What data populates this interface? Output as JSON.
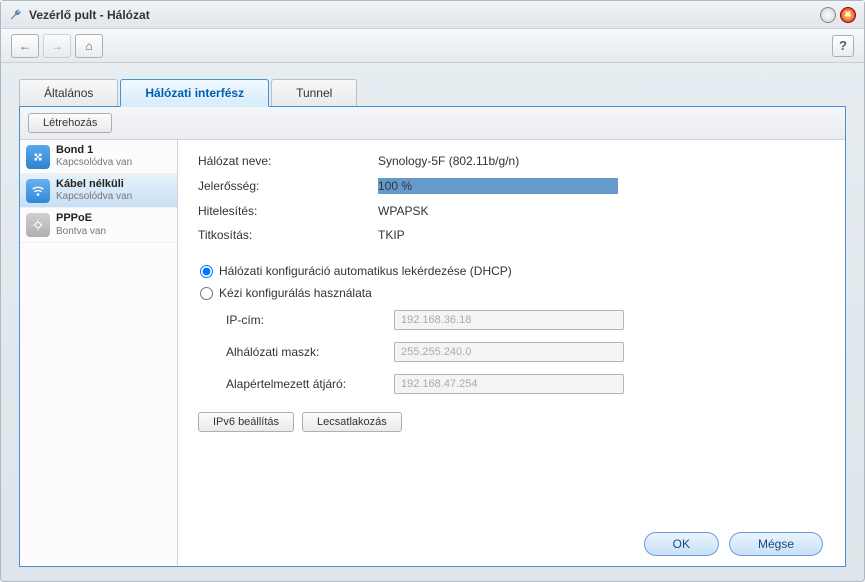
{
  "window": {
    "title": "Vezérlő pult - Hálózat"
  },
  "tabs": {
    "general": "Általános",
    "interface": "Hálózati interfész",
    "tunnel": "Tunnel"
  },
  "subtoolbar": {
    "create": "Létrehozás"
  },
  "sidebar": {
    "items": [
      {
        "name": "Bond 1",
        "status": "Kapcsolódva van",
        "icon": "bond-icon"
      },
      {
        "name": "Kábel nélküli",
        "status": "Kapcsolódva van",
        "icon": "wifi-icon"
      },
      {
        "name": "PPPoE",
        "status": "Bontva van",
        "icon": "pppoe-icon"
      }
    ]
  },
  "detail": {
    "labels": {
      "network_name": "Hálózat neve:",
      "strength": "Jelerősség:",
      "auth": "Hitelesítés:",
      "encryption": "Titkosítás:"
    },
    "values": {
      "network_name": "Synology-5F (802.11b/g/n)",
      "strength": "100 %",
      "auth": "WPAPSK",
      "encryption": "TKIP"
    },
    "radio_dhcp": "Hálózati konfiguráció automatikus lekérdezése (DHCP)",
    "radio_manual": "Kézi konfigurálás használata",
    "fields": {
      "ip_label": "IP-cím:",
      "subnet_label": "Alhálózati maszk:",
      "gateway_label": "Alapértelmezett átjáró:",
      "ip_value": "192.168.36.18",
      "subnet_value": "255.255.240.0",
      "gateway_value": "192.168.47.254"
    },
    "buttons": {
      "ipv6": "IPv6 beállítás",
      "disconnect": "Lecsatlakozás"
    }
  },
  "footer": {
    "ok": "OK",
    "cancel": "Mégse"
  }
}
